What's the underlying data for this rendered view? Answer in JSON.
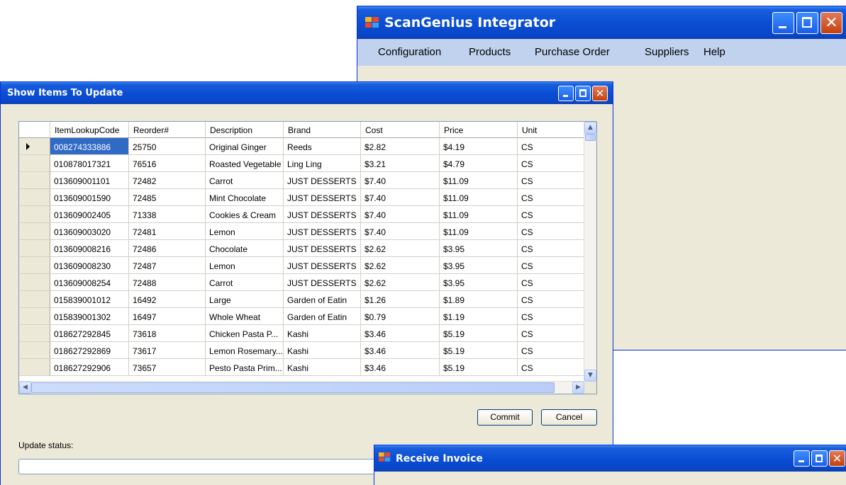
{
  "main_window": {
    "title": "ScanGenius Integrator",
    "menu": [
      "Configuration",
      "Products",
      "Purchase Order",
      "Suppliers",
      "Help"
    ]
  },
  "items_window": {
    "title": "Show Items To Update",
    "columns": [
      "ItemLookupCode",
      "Reorder#",
      "Description",
      "Brand",
      "Cost",
      "Price",
      "Unit"
    ],
    "rows": [
      [
        "008274333886",
        "25750",
        "Original Ginger",
        "Reeds",
        "$2.82",
        "$4.19",
        "CS"
      ],
      [
        "010878017321",
        "76516",
        "Roasted Vegetable",
        "Ling Ling",
        "$3.21",
        "$4.79",
        "CS"
      ],
      [
        "013609001101",
        "72482",
        "Carrot",
        "JUST DESSERTS",
        "$7.40",
        "$11.09",
        "CS"
      ],
      [
        "013609001590",
        "72485",
        "Mint Chocolate",
        "JUST DESSERTS",
        "$7.40",
        "$11.09",
        "CS"
      ],
      [
        "013609002405",
        "71338",
        "Cookies & Cream",
        "JUST DESSERTS",
        "$7.40",
        "$11.09",
        "CS"
      ],
      [
        "013609003020",
        "72481",
        "Lemon",
        "JUST DESSERTS",
        "$7.40",
        "$11.09",
        "CS"
      ],
      [
        "013609008216",
        "72486",
        "Chocolate",
        "JUST DESSERTS",
        "$2.62",
        "$3.95",
        "CS"
      ],
      [
        "013609008230",
        "72487",
        "Lemon",
        "JUST DESSERTS",
        "$2.62",
        "$3.95",
        "CS"
      ],
      [
        "013609008254",
        "72488",
        "Carrot",
        "JUST DESSERTS",
        "$2.62",
        "$3.95",
        "CS"
      ],
      [
        "015839001012",
        "16492",
        "Large",
        "Garden of Eatin",
        "$1.26",
        "$1.89",
        "CS"
      ],
      [
        "015839001302",
        "16497",
        "Whole Wheat",
        "Garden of Eatin",
        "$0.79",
        "$1.19",
        "CS"
      ],
      [
        "018627292845",
        "73618",
        "Chicken Pasta P...",
        "Kashi",
        "$3.46",
        "$5.19",
        "CS"
      ],
      [
        "018627292869",
        "73617",
        "Lemon Rosemary...",
        "Kashi",
        "$3.46",
        "$5.19",
        "CS"
      ],
      [
        "018627292906",
        "73657",
        "Pesto Pasta Prim...",
        "Kashi",
        "$3.46",
        "$5.19",
        "CS"
      ]
    ],
    "selected_row": 0,
    "commit_label": "Commit",
    "cancel_label": "Cancel",
    "status_label": "Update status:",
    "progress": 0
  },
  "invoice_window": {
    "title": "Receive Invoice"
  },
  "colors": {
    "titlebar": "#0a4ed4",
    "menubar": "#c1d2ee",
    "window_bg": "#ece9d8",
    "selection": "#316ac5",
    "close_button": "#c4400e"
  },
  "icons": {
    "app": "app-grid-icon",
    "minimize": "minimize-icon",
    "maximize": "maximize-icon",
    "close": "close-icon",
    "row_pointer": "row-pointer-icon"
  }
}
